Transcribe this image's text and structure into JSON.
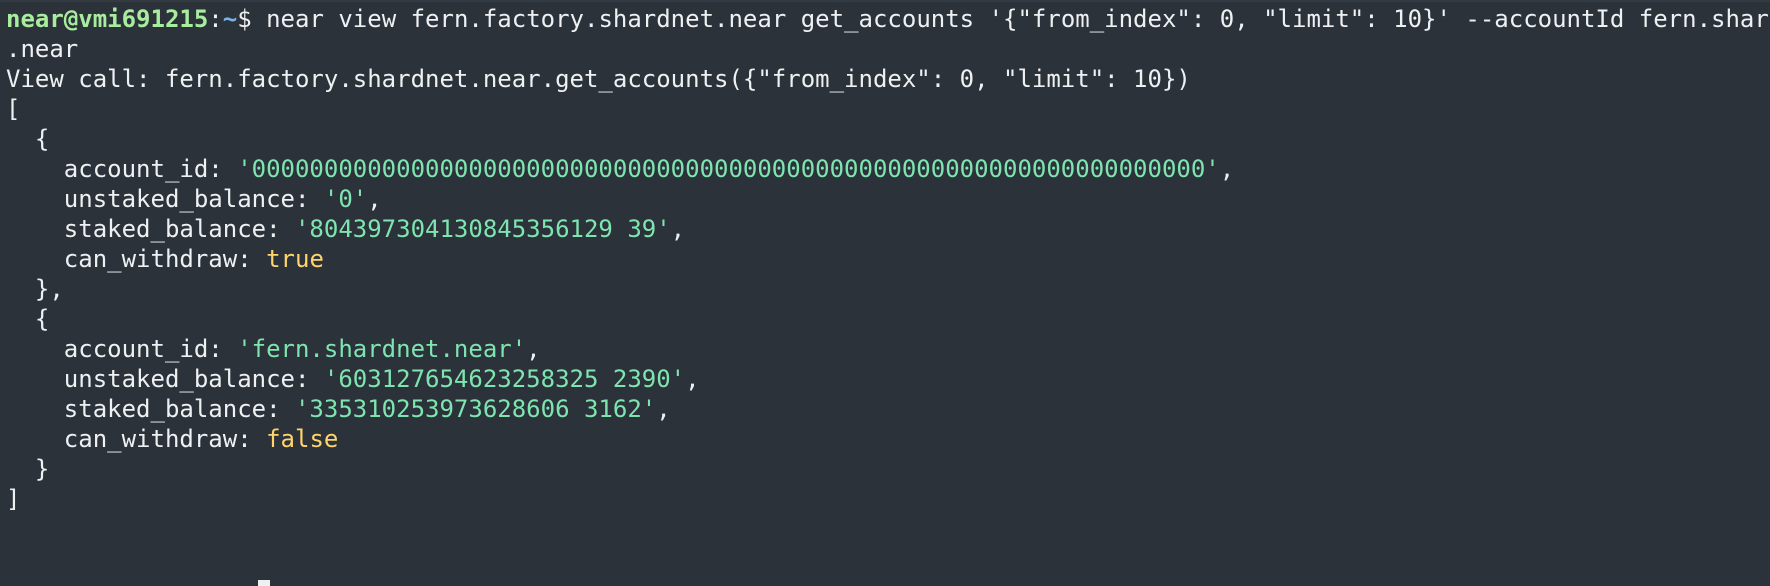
{
  "prompt": {
    "user_host": "near@vmi691215",
    "sep": ":",
    "path": "~",
    "dollar": "$",
    "command": " near view fern.factory.shardnet.near get_accounts '{\"from_index\": 0, \"limit\": 10}' --accountId fern.shardnet",
    "command_wrap": ".near"
  },
  "output": {
    "view_call": "View call: fern.factory.shardnet.near.get_accounts({\"from_index\": 0, \"limit\": 10})",
    "open_bracket": "[",
    "close_bracket": "]",
    "accounts": [
      {
        "open": "  {",
        "account_id_key": "    account_id: ",
        "account_id": "'000000000000000000000000000000000000000000000000000000000000000000'",
        "account_id_comma": ",",
        "unstaked_key": "    unstaked_balance: ",
        "unstaked": "'0'",
        "unstaked_comma": ",",
        "staked_key": "    staked_balance: ",
        "staked": "'804397304130845356129 39'",
        "staked_comma": ",",
        "withdraw_key": "    can_withdraw: ",
        "withdraw": "true",
        "close": "  },"
      },
      {
        "open": "  {",
        "account_id_key": "    account_id: ",
        "account_id": "'fern.shardnet.near'",
        "account_id_comma": ",",
        "unstaked_key": "    unstaked_balance: ",
        "unstaked": "'603127654623258325 2390'",
        "unstaked_comma": ",",
        "staked_key": "    staked_balance: ",
        "staked": "'335310253973628606 3162'",
        "staked_comma": ",",
        "withdraw_key": "    can_withdraw: ",
        "withdraw": "false",
        "close": "  }"
      }
    ]
  },
  "colors": {
    "background": "#2b323a",
    "text": "#eef0f2",
    "prompt_user": "#a8ec9d",
    "prompt_path": "#7ab3e8",
    "string": "#7fe5b0",
    "boolean": "#ffd46b"
  }
}
